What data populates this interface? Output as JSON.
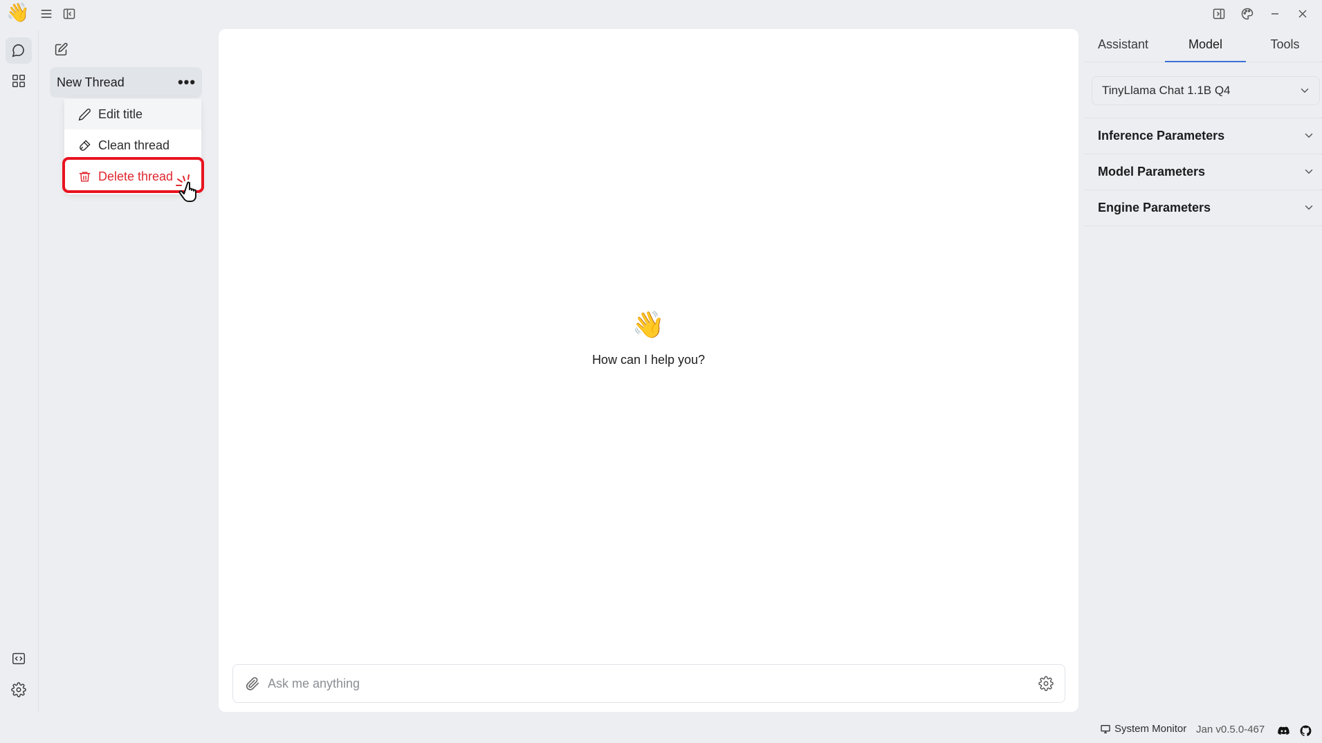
{
  "titlebar": {
    "logo_icon": "waving-hand-emoji",
    "logo_glyph": "👋",
    "icons": [
      "menu-icon",
      "sidebar-toggle-icon",
      "right-panel-toggle-icon",
      "palette-icon",
      "minimize-icon",
      "close-icon"
    ]
  },
  "rail": {
    "items": [
      {
        "name": "chat-icon",
        "active": true
      },
      {
        "name": "hub-grid-icon",
        "active": false
      },
      {
        "name": "code-window-icon",
        "active": false
      },
      {
        "name": "settings-icon",
        "active": false
      }
    ]
  },
  "threads": {
    "new_thread_icon": "compose-icon",
    "items": [
      {
        "title": "New Thread",
        "more_label": "•••"
      }
    ]
  },
  "context_menu": {
    "items": [
      {
        "label": "Edit title",
        "icon": "pencil-icon"
      },
      {
        "label": "Clean thread",
        "icon": "brush-icon"
      },
      {
        "label": "Delete thread",
        "icon": "trash-icon",
        "danger": true
      }
    ]
  },
  "main": {
    "welcome_emoji": "👋",
    "welcome_text": "How can I help you?",
    "input": {
      "placeholder": "Ask me anything",
      "value": ""
    }
  },
  "right_panel": {
    "tabs": [
      {
        "label": "Assistant",
        "active": false
      },
      {
        "label": "Model",
        "active": true
      },
      {
        "label": "Tools",
        "active": false
      }
    ],
    "model_select": {
      "value": "TinyLlama Chat 1.1B Q4"
    },
    "sections": [
      {
        "label": "Inference Parameters"
      },
      {
        "label": "Model Parameters"
      },
      {
        "label": "Engine Parameters"
      }
    ]
  },
  "statusbar": {
    "system_monitor_label": "System Monitor",
    "version": "Jan v0.5.0-467"
  },
  "colors": {
    "accent": "#3b6fd6",
    "danger": "#e0272f",
    "highlight": "#e8131f",
    "background": "#eceef1"
  }
}
